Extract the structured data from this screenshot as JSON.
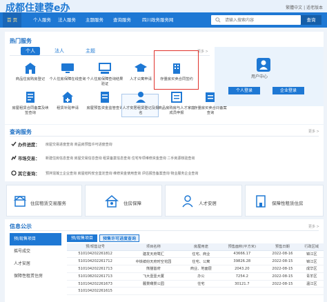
{
  "header": {
    "logo": "成都住建蓉e办",
    "top_links": "繁體中文 | 适老版本"
  },
  "nav": {
    "items": [
      "首 页",
      "个人服务",
      "法人服务",
      "主题服务",
      "查询服务",
      "四川政务服务网"
    ],
    "search_placeholder": "请输入搜索内容",
    "search_button": "查询"
  },
  "hot": {
    "title": "热门服务",
    "tabs": [
      "个人",
      "法人",
      "主题"
    ],
    "more": "更多 >",
    "services": [
      "商品住房购房登记",
      "个人住房保障在线查询",
      "个人住房保障查询结果验证",
      "人才公寓申请",
      "存量房买卖合同签约",
      "房屋租赁合同备案及续签查询",
      "租赁补贴申请",
      "房屋预售资金监管查询",
      "人才安居租赁登记及报名",
      "商品房购房与人才家庭成员申报",
      "存量房买卖合同备案查询"
    ]
  },
  "user_center": {
    "label": "用户中心",
    "personal_login": "个人登录",
    "enterprise_login": "企业登录"
  },
  "query": {
    "title": "查询服务",
    "more": "更多 >",
    "rows": [
      {
        "label": "办件进度：",
        "items": "房屋交易进度查询  商品房预售许可进度查询"
      },
      {
        "label": "市场交易：",
        "items": "新建住房信息查询  房屋交易信息查询  租赁备案信息查询  住宅专项维修资金查询  二手房源核验查询"
      },
      {
        "label": "其它查询：",
        "items": "预拌混凝土企业查询  房屋结构安全鉴定查询  维修资金使用查询  评估报告备案查询  物业服务企业查询"
      }
    ]
  },
  "banners": [
    "住房租赁交易服务",
    "住房保障",
    "人才安居",
    "保障性租赁住房"
  ],
  "info": {
    "title": "信息公示",
    "more": "更多 >",
    "side": [
      "预/现售项目",
      "摇号成交",
      "人才安居",
      "保障性租赁住房"
    ],
    "table_tabs": [
      "预/现售项目",
      "预售许可进度查询"
    ],
    "columns": [
      "预/现售证号",
      "项目名称",
      "房屋用途",
      "预售面积(平方米)",
      "预售日期",
      "行政区域"
    ],
    "rows": [
      [
        "510104202261812",
        "建发天府鹭汇",
        "住宅、商业",
        "43666.17",
        "2022-08-16",
        "锦江区"
      ],
      [
        "510104202261712",
        "中铁缤纷天府时空花园",
        "住宅、公寓",
        "39826.28",
        "2022-08-15",
        "锦江区"
      ],
      [
        "510104202261713",
        "熊猫首府",
        "商业、地面层",
        "2043.20",
        "2022-08-15",
        "成华区"
      ],
      [
        "510108202261713",
        "飞大壹壹大厦",
        "办公",
        "7254.2",
        "2022-08-15",
        "青羊区"
      ],
      [
        "510104202261673",
        "麓景瞰景公园",
        "住宅",
        "30121.7",
        "2022-08-15",
        "温江区"
      ],
      [
        "510104202261615",
        "",
        "",
        "",
        "",
        ""
      ]
    ]
  },
  "colors": {
    "primary": "#1e78d4",
    "highlight_box": "#e0312b"
  }
}
